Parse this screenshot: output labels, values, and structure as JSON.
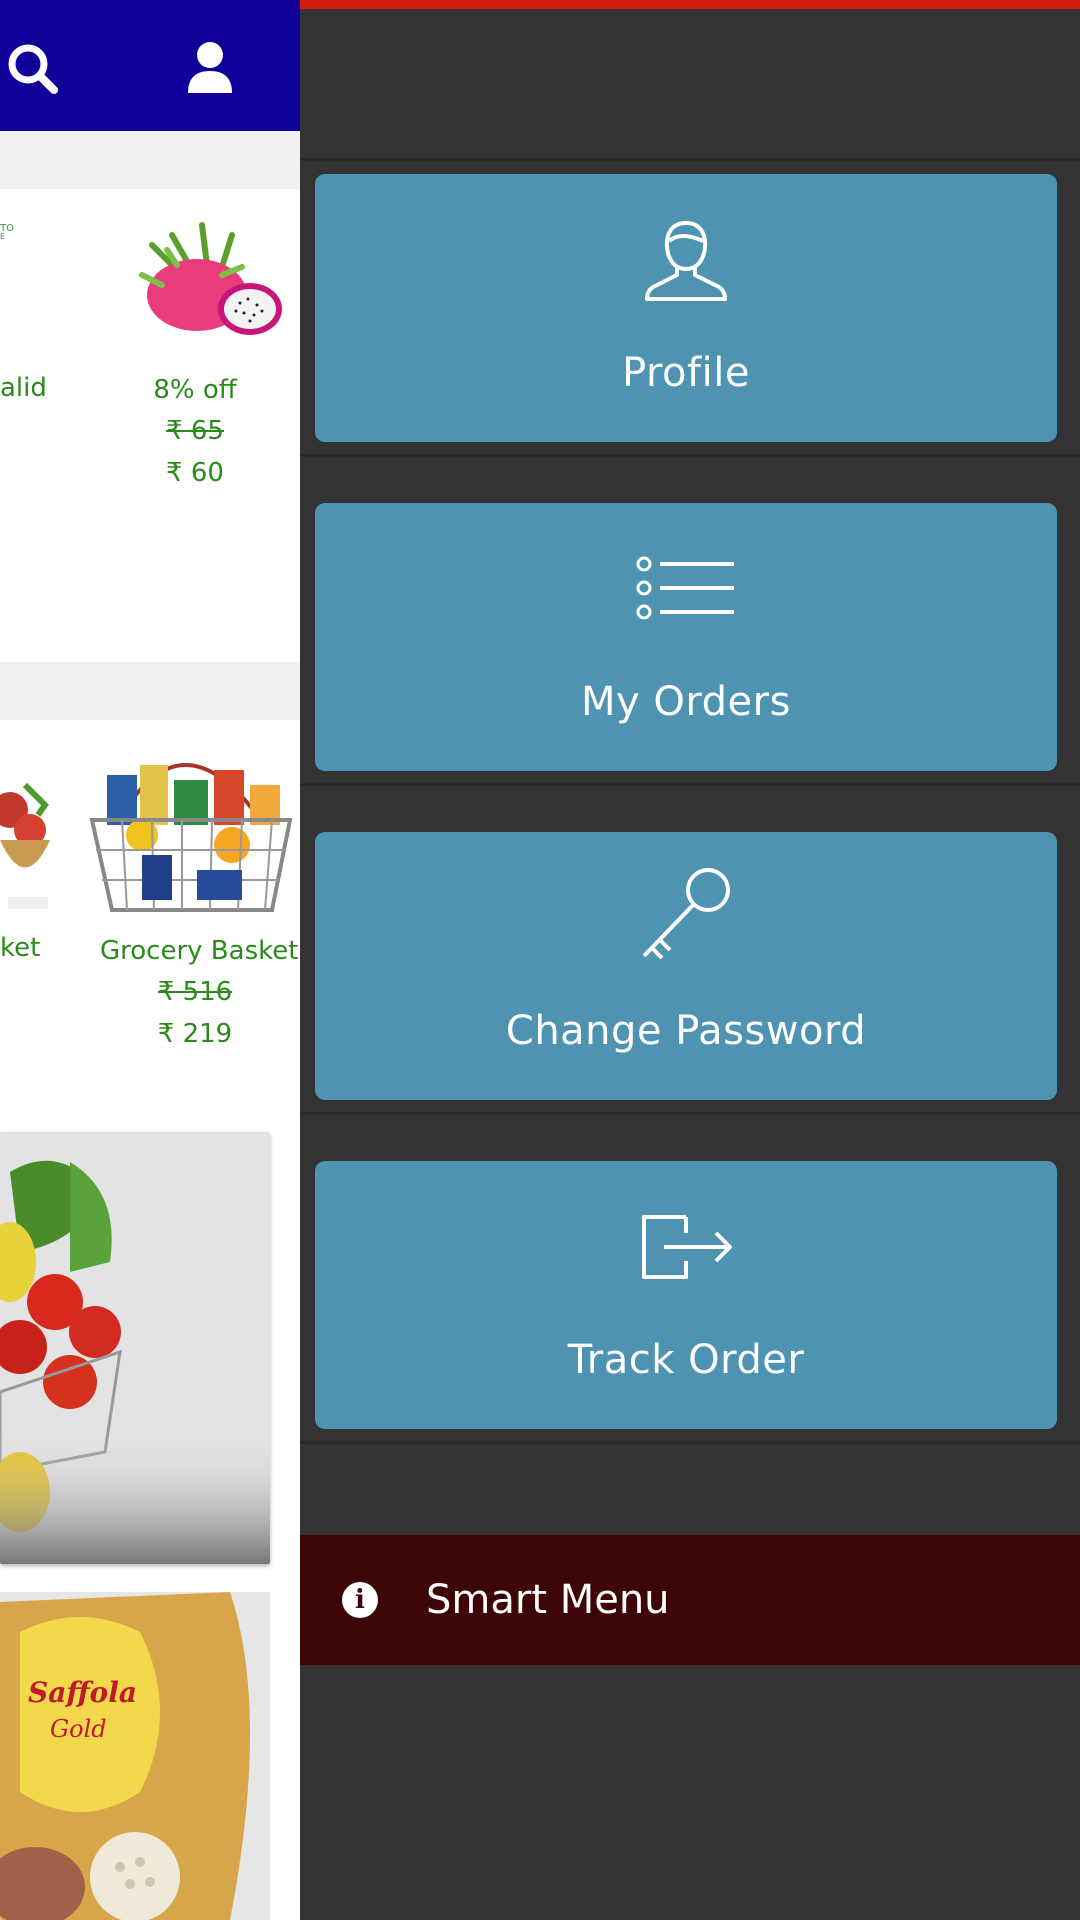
{
  "header": {
    "icons": [
      "search-icon",
      "user-icon"
    ],
    "color": "#10009a"
  },
  "products_row1": [
    {
      "partial_name": "alid"
    },
    {
      "discount": "8% off",
      "old_price": "₹ 65",
      "price": "₹ 60",
      "image": "dragon-fruit"
    }
  ],
  "products_row2": [
    {
      "partial_name": "ket"
    },
    {
      "name": "Grocery Basket",
      "old_price": "₹ 516",
      "price": "₹ 219",
      "image": "grocery-basket"
    }
  ],
  "banners": [
    {
      "image": "vegetable-basket"
    },
    {
      "image": "saffola-gold-pack"
    }
  ],
  "drawer": {
    "accent_color": "#d41e0b",
    "tile_color": "#4e93b1",
    "tiles": [
      {
        "label": "Profile",
        "icon": "profile-icon"
      },
      {
        "label": "My Orders",
        "icon": "list-icon"
      },
      {
        "label": "Change Password",
        "icon": "key-icon"
      },
      {
        "label": "Track Order",
        "icon": "logout-icon"
      }
    ],
    "smart_menu": {
      "label": "Smart Menu",
      "icon": "info-icon",
      "color": "#3d0505"
    }
  }
}
